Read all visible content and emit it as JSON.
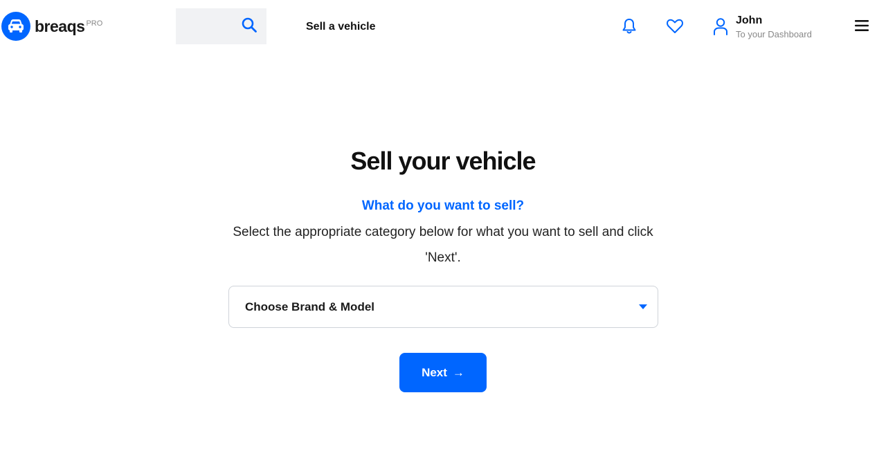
{
  "header": {
    "logo_text": "breaqs",
    "logo_badge": "PRO",
    "search_icon": "search-icon",
    "nav_sell": "Sell a vehicle",
    "notifications_icon": "bell-icon",
    "favorites_icon": "heart-icon",
    "user_name": "John",
    "user_sub": "To your Dashboard",
    "menu_icon": "hamburger-menu-icon"
  },
  "main": {
    "title": "Sell your vehicle",
    "question": "What do you want to sell?",
    "instructions": "Select the appropriate category below for what you want to sell and click 'Next'.",
    "select_label": "Choose Brand & Model",
    "next_label": "Next",
    "next_arrow": "→"
  },
  "colors": {
    "accent": "#0066ff",
    "background": "#ffffff",
    "text": "#111111",
    "muted": "#888888",
    "search_bg": "#f1f2f4",
    "border": "#cfd3d9"
  }
}
